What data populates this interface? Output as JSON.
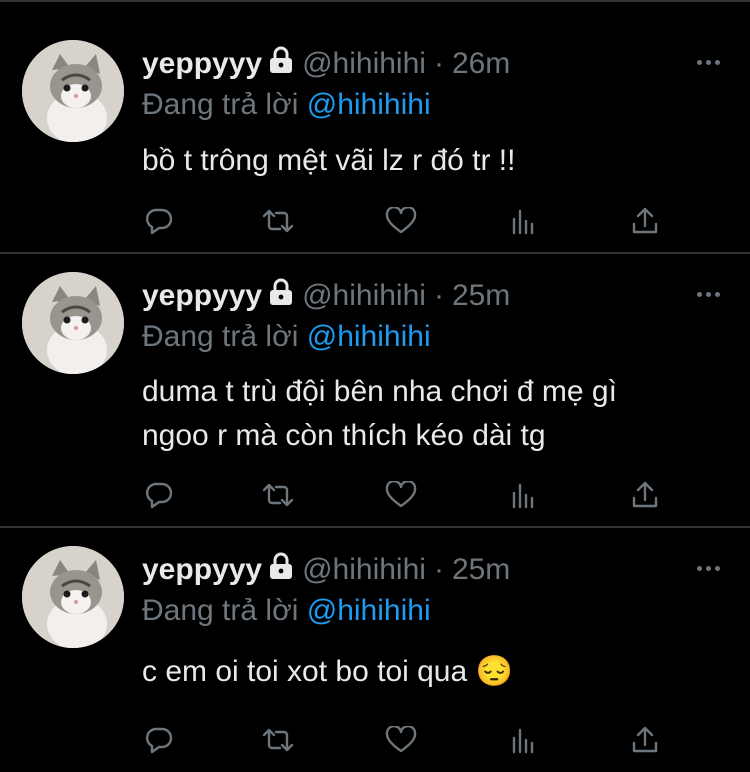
{
  "tweets": [
    {
      "name": "yeppyyy",
      "handle": "@hihihihi",
      "separator": "·",
      "time": "26m",
      "reply_prefix": "Đang trả lời",
      "reply_to": "@hihihihi",
      "text_lines": [
        "bồ t trông mệt vãi lz r đó tr !!"
      ]
    },
    {
      "name": "yeppyyy",
      "handle": "@hihihihi",
      "separator": "·",
      "time": "25m",
      "reply_prefix": "Đang trả lời",
      "reply_to": "@hihihihi",
      "text_lines": [
        "duma t trù đội bên nha chơi đ mẹ gì",
        "ngoo r mà còn thích kéo dài tg"
      ]
    },
    {
      "name": "yeppyyy",
      "handle": "@hihihihi",
      "separator": "·",
      "time": "25m",
      "reply_prefix": "Đang trả lời",
      "reply_to": "@hihihihi",
      "text_lines": [
        "c em oi toi xot bo toi qua 😔"
      ]
    }
  ],
  "icons": {
    "avatar": "kitten-avatar",
    "lock": "lock-icon",
    "more": "more-icon",
    "reply": "reply-icon",
    "retweet": "retweet-icon",
    "like": "heart-icon",
    "analytics": "analytics-icon",
    "share": "share-icon"
  },
  "colors": {
    "background": "#000000",
    "text": "#e7e9ea",
    "muted": "#6e767d",
    "mention": "#1d9bf0",
    "divider": "#2f3336"
  }
}
